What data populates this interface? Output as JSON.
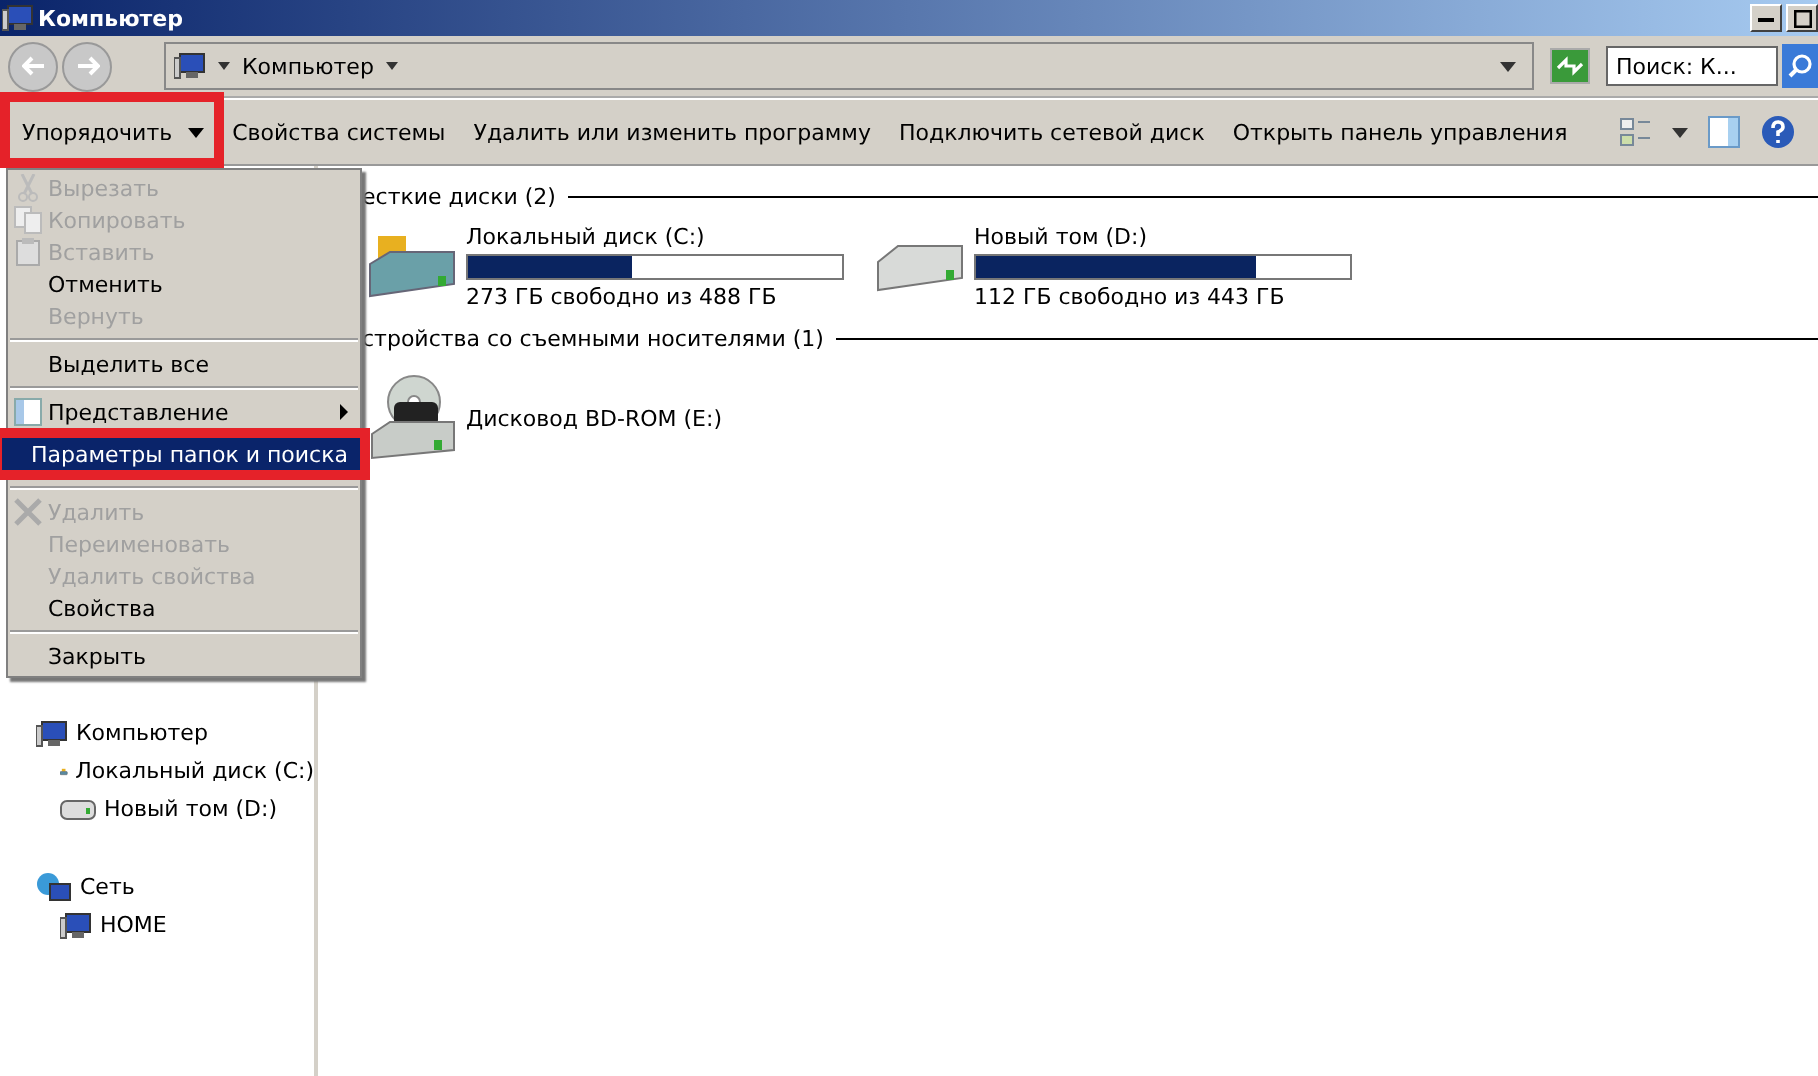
{
  "window": {
    "title": "Компьютер"
  },
  "address": {
    "path": "Компьютер",
    "search_placeholder": "Поиск: К..."
  },
  "toolbar": {
    "organize": "Упорядочить",
    "buttons": [
      "Свойства системы",
      "Удалить или изменить программу",
      "Подключить сетевой диск",
      "Открыть панель управления"
    ]
  },
  "menu": {
    "items": [
      {
        "kind": "item",
        "label": "Вырезать",
        "disabled": true,
        "selected": false
      },
      {
        "kind": "item",
        "label": "Копировать",
        "disabled": true,
        "selected": false
      },
      {
        "kind": "item",
        "label": "Вставить",
        "disabled": true,
        "selected": false
      },
      {
        "kind": "item",
        "label": "Отменить",
        "disabled": false,
        "selected": false
      },
      {
        "kind": "item",
        "label": "Вернуть",
        "disabled": true,
        "selected": false
      },
      {
        "kind": "separator"
      },
      {
        "kind": "item",
        "label": "Выделить все",
        "disabled": false,
        "selected": false
      },
      {
        "kind": "separator"
      },
      {
        "kind": "submenu",
        "label": "Представление",
        "disabled": false,
        "selected": false
      },
      {
        "kind": "item",
        "label": "Параметры папок и поиска",
        "disabled": false,
        "selected": true
      },
      {
        "kind": "separator"
      },
      {
        "kind": "item",
        "label": "Удалить",
        "disabled": true,
        "selected": false
      },
      {
        "kind": "item",
        "label": "Переименовать",
        "disabled": true,
        "selected": false
      },
      {
        "kind": "item",
        "label": "Удалить свойства",
        "disabled": true,
        "selected": false
      },
      {
        "kind": "item",
        "label": "Свойства",
        "disabled": false,
        "selected": false
      },
      {
        "kind": "separator"
      },
      {
        "kind": "item",
        "label": "Закрыть",
        "disabled": false,
        "selected": false
      }
    ]
  },
  "sidebar": {
    "items": [
      {
        "label": "Компьютер",
        "children": [
          {
            "label": "Локальный диск (C:)"
          },
          {
            "label": "Новый том (D:)"
          }
        ]
      },
      {
        "label": "Сеть",
        "children": [
          {
            "label": "HOME"
          }
        ]
      }
    ]
  },
  "groups": [
    {
      "title": "есткие диски (2)",
      "items": [
        {
          "kind": "system_drive",
          "name": "Локальный диск (C:)",
          "level": 0.44,
          "free": "273 ГБ свободно из 488 ГБ"
        },
        {
          "kind": "drive",
          "name": "Новый том (D:)",
          "level": 0.75,
          "free": "112 ГБ свободно из 443 ГБ"
        }
      ]
    },
    {
      "title": "стройства со съемными носителями (1)",
      "items": [
        {
          "kind": "optical",
          "name": "Дисковод BD-ROM (E:)"
        }
      ]
    }
  ]
}
